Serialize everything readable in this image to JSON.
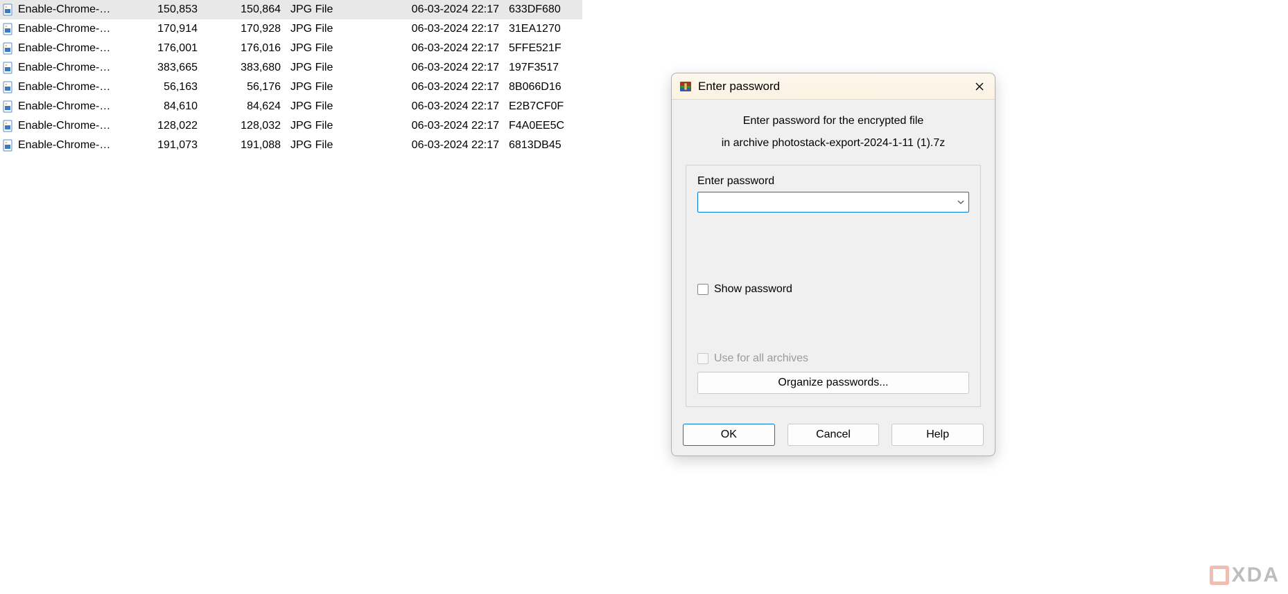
{
  "files": [
    {
      "name": "Enable-Chrome-…",
      "size": "150,853",
      "packed": "150,864",
      "type": "JPG File",
      "date": "06-03-2024 22:17",
      "crc": "633DF680",
      "selected": true
    },
    {
      "name": "Enable-Chrome-…",
      "size": "170,914",
      "packed": "170,928",
      "type": "JPG File",
      "date": "06-03-2024 22:17",
      "crc": "31EA1270",
      "selected": false
    },
    {
      "name": "Enable-Chrome-…",
      "size": "176,001",
      "packed": "176,016",
      "type": "JPG File",
      "date": "06-03-2024 22:17",
      "crc": "5FFE521F",
      "selected": false
    },
    {
      "name": "Enable-Chrome-…",
      "size": "383,665",
      "packed": "383,680",
      "type": "JPG File",
      "date": "06-03-2024 22:17",
      "crc": "197F3517",
      "selected": false
    },
    {
      "name": "Enable-Chrome-…",
      "size": "56,163",
      "packed": "56,176",
      "type": "JPG File",
      "date": "06-03-2024 22:17",
      "crc": "8B066D16",
      "selected": false
    },
    {
      "name": "Enable-Chrome-…",
      "size": "84,610",
      "packed": "84,624",
      "type": "JPG File",
      "date": "06-03-2024 22:17",
      "crc": "E2B7CF0F",
      "selected": false
    },
    {
      "name": "Enable-Chrome-…",
      "size": "128,022",
      "packed": "128,032",
      "type": "JPG File",
      "date": "06-03-2024 22:17",
      "crc": "F4A0EE5C",
      "selected": false
    },
    {
      "name": "Enable-Chrome-…",
      "size": "191,073",
      "packed": "191,088",
      "type": "JPG File",
      "date": "06-03-2024 22:17",
      "crc": "6813DB45",
      "selected": false
    }
  ],
  "dialog": {
    "title": "Enter password",
    "prompt1": "Enter password for the encrypted file",
    "prompt2": "in archive photostack-export-2024-1-11 (1).7z",
    "field_label": "Enter password",
    "password_value": "",
    "show_password_label": "Show password",
    "use_all_label": "Use for all archives",
    "organize_label": "Organize passwords...",
    "ok_label": "OK",
    "cancel_label": "Cancel",
    "help_label": "Help"
  },
  "watermark": {
    "text": "XDA"
  }
}
